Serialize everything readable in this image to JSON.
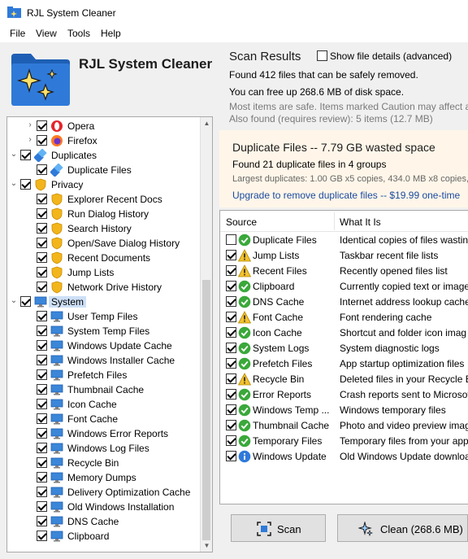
{
  "window": {
    "title": "RJL System Cleaner"
  },
  "menu": [
    "File",
    "View",
    "Tools",
    "Help"
  ],
  "brand": {
    "name": "RJL System Cleaner",
    "logo_icon": "folder-sparkle-icon"
  },
  "tree": [
    {
      "label": "Opera",
      "level": 1,
      "icon": "opera-icon",
      "chevron": "right"
    },
    {
      "label": "Firefox",
      "level": 1,
      "icon": "firefox-icon",
      "chevron": "right"
    },
    {
      "label": "Duplicates",
      "level": 0,
      "icon": "duplicates-icon",
      "chevron": "down"
    },
    {
      "label": "Duplicate Files",
      "level": 1,
      "icon": "duplicates-icon",
      "chevron": "none"
    },
    {
      "label": "Privacy",
      "level": 0,
      "icon": "shield-icon",
      "chevron": "down"
    },
    {
      "label": "Explorer Recent Docs",
      "level": 1,
      "icon": "shield-icon",
      "chevron": "none"
    },
    {
      "label": "Run Dialog History",
      "level": 1,
      "icon": "shield-icon",
      "chevron": "none"
    },
    {
      "label": "Search History",
      "level": 1,
      "icon": "shield-icon",
      "chevron": "none"
    },
    {
      "label": "Open/Save Dialog History",
      "level": 1,
      "icon": "shield-icon",
      "chevron": "none"
    },
    {
      "label": "Recent Documents",
      "level": 1,
      "icon": "shield-icon",
      "chevron": "none"
    },
    {
      "label": "Jump Lists",
      "level": 1,
      "icon": "shield-icon",
      "chevron": "none"
    },
    {
      "label": "Network Drive History",
      "level": 1,
      "icon": "shield-icon",
      "chevron": "none"
    },
    {
      "label": "System",
      "level": 0,
      "icon": "monitor-icon",
      "chevron": "down",
      "selected": true
    },
    {
      "label": "User Temp Files",
      "level": 1,
      "icon": "monitor-icon",
      "chevron": "none"
    },
    {
      "label": "System Temp Files",
      "level": 1,
      "icon": "monitor-icon",
      "chevron": "none"
    },
    {
      "label": "Windows Update Cache",
      "level": 1,
      "icon": "monitor-icon",
      "chevron": "none"
    },
    {
      "label": "Windows Installer Cache",
      "level": 1,
      "icon": "monitor-icon",
      "chevron": "none"
    },
    {
      "label": "Prefetch Files",
      "level": 1,
      "icon": "monitor-icon",
      "chevron": "none"
    },
    {
      "label": "Thumbnail Cache",
      "level": 1,
      "icon": "monitor-icon",
      "chevron": "none"
    },
    {
      "label": "Icon Cache",
      "level": 1,
      "icon": "monitor-icon",
      "chevron": "none"
    },
    {
      "label": "Font Cache",
      "level": 1,
      "icon": "monitor-icon",
      "chevron": "none"
    },
    {
      "label": "Windows Error Reports",
      "level": 1,
      "icon": "monitor-icon",
      "chevron": "none"
    },
    {
      "label": "Windows Log Files",
      "level": 1,
      "icon": "monitor-icon",
      "chevron": "none"
    },
    {
      "label": "Recycle Bin",
      "level": 1,
      "icon": "monitor-icon",
      "chevron": "none"
    },
    {
      "label": "Memory Dumps",
      "level": 1,
      "icon": "monitor-icon",
      "chevron": "none"
    },
    {
      "label": "Delivery Optimization Cache",
      "level": 1,
      "icon": "monitor-icon",
      "chevron": "none"
    },
    {
      "label": "Old Windows Installation",
      "level": 1,
      "icon": "monitor-icon",
      "chevron": "none"
    },
    {
      "label": "DNS Cache",
      "level": 1,
      "icon": "monitor-icon",
      "chevron": "none"
    },
    {
      "label": "Clipboard",
      "level": 1,
      "icon": "monitor-icon",
      "chevron": "none"
    }
  ],
  "scan": {
    "title": "Scan Results",
    "show_details_label": "Show file details (advanced)",
    "show_details_checked": false,
    "found_line": "Found 412 files that can be safely removed.",
    "free_line": "You can free up 268.6 MB of disk space.",
    "safe_line": "Most items are safe. Items marked Caution may affect a",
    "review_line": "Also found (requires review): 5 items (12.7 MB)"
  },
  "duplicates": {
    "title": "Duplicate Files -- 7.79 GB wasted space",
    "found": "Found 21 duplicate files in 4 groups",
    "largest": "Largest duplicates: 1.00 GB x5 copies, 434.0 MB x8 copies,",
    "upgrade": "Upgrade to remove duplicate files -- $19.99 one-time"
  },
  "results": {
    "col_source": "Source",
    "col_what": "What It Is",
    "rows": [
      {
        "checked": false,
        "status": "ok",
        "source": "Duplicate Files",
        "what": "Identical copies of files wastin"
      },
      {
        "checked": true,
        "status": "caution",
        "source": "Jump Lists",
        "what": "Taskbar recent file lists"
      },
      {
        "checked": true,
        "status": "caution",
        "source": "Recent Files",
        "what": "Recently opened files list"
      },
      {
        "checked": true,
        "status": "ok",
        "source": "Clipboard",
        "what": "Currently copied text or image"
      },
      {
        "checked": true,
        "status": "ok",
        "source": "DNS Cache",
        "what": "Internet address lookup cache"
      },
      {
        "checked": true,
        "status": "caution",
        "source": "Font Cache",
        "what": "Font rendering cache"
      },
      {
        "checked": true,
        "status": "ok",
        "source": "Icon Cache",
        "what": "Shortcut and folder icon imag"
      },
      {
        "checked": true,
        "status": "ok",
        "source": "System Logs",
        "what": "System diagnostic logs"
      },
      {
        "checked": true,
        "status": "ok",
        "source": "Prefetch Files",
        "what": "App startup optimization files"
      },
      {
        "checked": true,
        "status": "caution",
        "source": "Recycle Bin",
        "what": "Deleted files in your Recycle B"
      },
      {
        "checked": true,
        "status": "ok",
        "source": "Error Reports",
        "what": "Crash reports sent to Microsof"
      },
      {
        "checked": true,
        "status": "ok",
        "source": "Windows Temp ...",
        "what": "Windows temporary files"
      },
      {
        "checked": true,
        "status": "ok",
        "source": "Thumbnail Cache",
        "what": "Photo and video preview imag"
      },
      {
        "checked": true,
        "status": "ok",
        "source": "Temporary Files",
        "what": "Temporary files from your app"
      },
      {
        "checked": true,
        "status": "info",
        "source": "Windows Update",
        "what": "Old Windows Update downloa"
      }
    ]
  },
  "buttons": {
    "scan_label": "Scan",
    "scan_icon": "scan-frame-icon",
    "clean_label": "Clean (268.6 MB)",
    "clean_icon": "sparkle-icon"
  },
  "colors": {
    "accent_blue": "#1a4ba1",
    "ok_green": "#3aa83a",
    "caution_yellow": "#f2c12e",
    "info_blue": "#2f7ad9",
    "dup_box_bg": "#fff6e9",
    "selection": "#cde0f7"
  }
}
